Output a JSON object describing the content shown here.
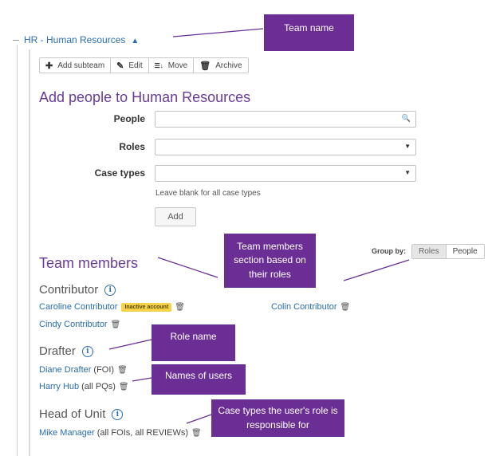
{
  "team": {
    "link": "HR - Human Resources",
    "caret": "▲"
  },
  "toolbar": {
    "add_subteam": "Add subteam",
    "edit": "Edit",
    "move": "Move",
    "archive": "Archive",
    "icons": [
      "plus-icon",
      "pencil-icon",
      "move-icon",
      "trash-icon"
    ]
  },
  "add_people": {
    "heading": "Add people to Human Resources",
    "people_label": "People",
    "people_value": "",
    "roles_label": "Roles",
    "roles_value": "",
    "case_types_label": "Case types",
    "case_types_value": "",
    "hint": "Leave blank for all case types",
    "add_button": "Add"
  },
  "team_members": {
    "heading": "Team members",
    "group_by_label": "Group by:",
    "group_by_options": [
      "Roles",
      "People"
    ],
    "group_by_selected": "Roles",
    "roles": [
      {
        "name": "Contributor",
        "people": [
          {
            "name": "Caroline Contributor",
            "badge": "Inactive account"
          },
          {
            "name": "Colin Contributor"
          },
          {
            "name": "Cindy Contributor"
          }
        ]
      },
      {
        "name": "Drafter",
        "people": [
          {
            "name": "Diane Drafter",
            "extra": "(FOI)"
          },
          {
            "name": "Harry Hub",
            "extra": "(all PQs)"
          }
        ]
      },
      {
        "name": "Head of Unit",
        "people": [
          {
            "name": "Mike Manager",
            "extra": "(all FOIs, all REVIEWs)"
          }
        ]
      }
    ]
  },
  "callouts": {
    "team_name": "Team name",
    "team_members_section": "Team members section based on their roles",
    "role_name": "Role name",
    "names_of_users": "Names of users",
    "case_types": "Case types the user's role is responsible for"
  },
  "colors": {
    "accent_purple": "#6a3b96",
    "callout_bg": "#6a2e94",
    "link_blue": "#2a6db0",
    "badge_yellow": "#f5d24a"
  }
}
